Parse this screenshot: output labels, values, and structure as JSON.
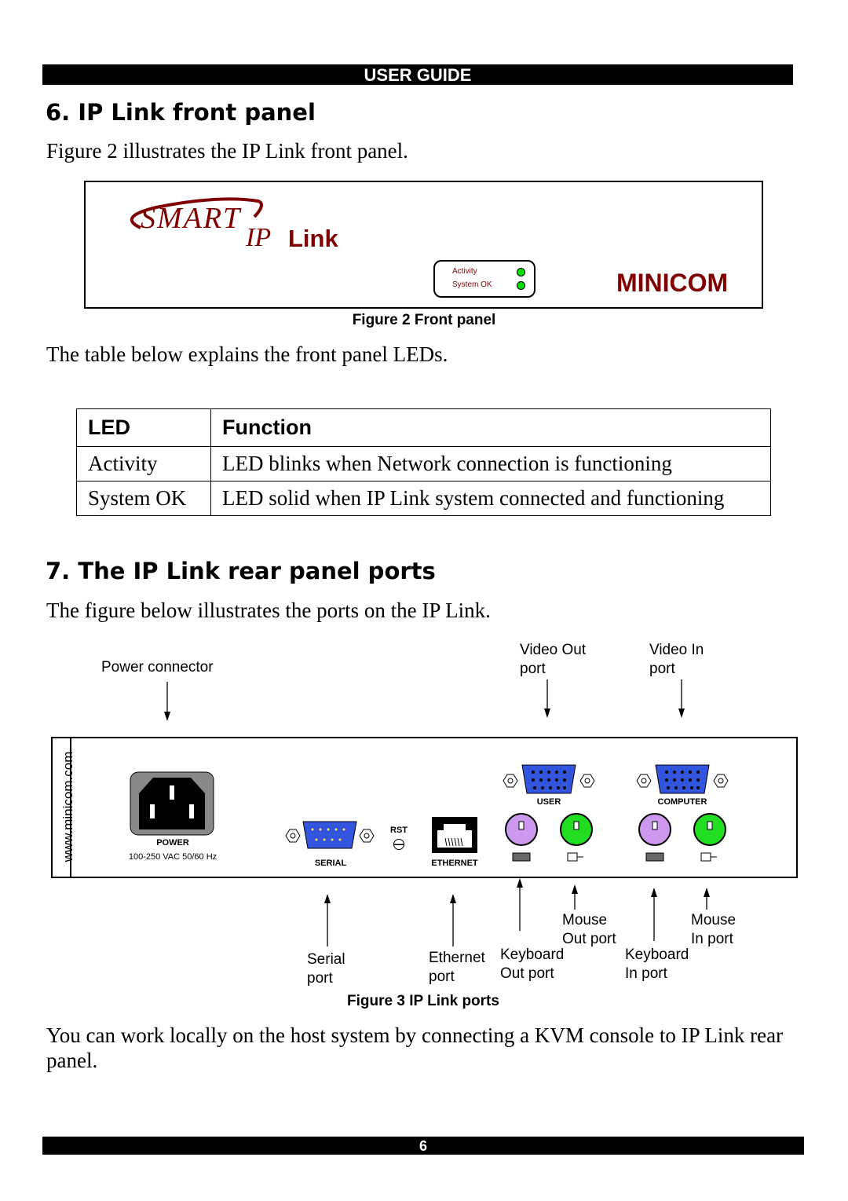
{
  "header": {
    "title": "USER GUIDE"
  },
  "section6": {
    "title": "6.  IP Link front panel",
    "intro": "Figure 2 illustrates the IP Link front panel.",
    "front_panel": {
      "logo_smart": "SMART",
      "logo_ip": "IP",
      "logo_link": "Link",
      "led_activity": "Activity",
      "led_system_ok": "System OK",
      "brand": "MINICOM",
      "led_color": "#00e000",
      "brand_color": "#800000"
    },
    "caption": "Figure 2 Front panel",
    "table_intro": "The table below explains the front panel LEDs.",
    "table": {
      "headers": [
        "LED",
        "Function"
      ],
      "rows": [
        [
          "Activity",
          "LED blinks when Network connection is functioning"
        ],
        [
          "System OK",
          "LED solid when IP Link system connected and functioning"
        ]
      ]
    }
  },
  "section7": {
    "title": "7.  The IP Link rear panel ports",
    "intro": "The figure below illustrates the ports on the IP Link.",
    "rear_panel": {
      "website": "www.minicom.com",
      "power": "POWER",
      "power_spec": "100-250 VAC 50/60 Hz",
      "serial": "SERIAL",
      "rst": "RST",
      "ethernet": "ETHERNET",
      "user": "USER",
      "computer": "COMPUTER"
    },
    "callouts": {
      "power_connector": "Power connector",
      "video_out": [
        "Video Out",
        "port"
      ],
      "video_in": [
        "Video In",
        "port"
      ],
      "serial": [
        "Serial",
        "port"
      ],
      "ethernet": [
        "Ethernet",
        "port"
      ],
      "keyboard_out": [
        "Keyboard",
        "Out port"
      ],
      "mouse_out": [
        "Mouse",
        "Out port"
      ],
      "keyboard_in": [
        "Keyboard",
        "In port"
      ],
      "mouse_in": [
        "Mouse",
        "In port"
      ]
    },
    "caption": "Figure 3 IP Link ports",
    "outro": "You can work locally on the host system by connecting a KVM console to IP Link rear panel."
  },
  "footer": {
    "page_number": "6"
  }
}
